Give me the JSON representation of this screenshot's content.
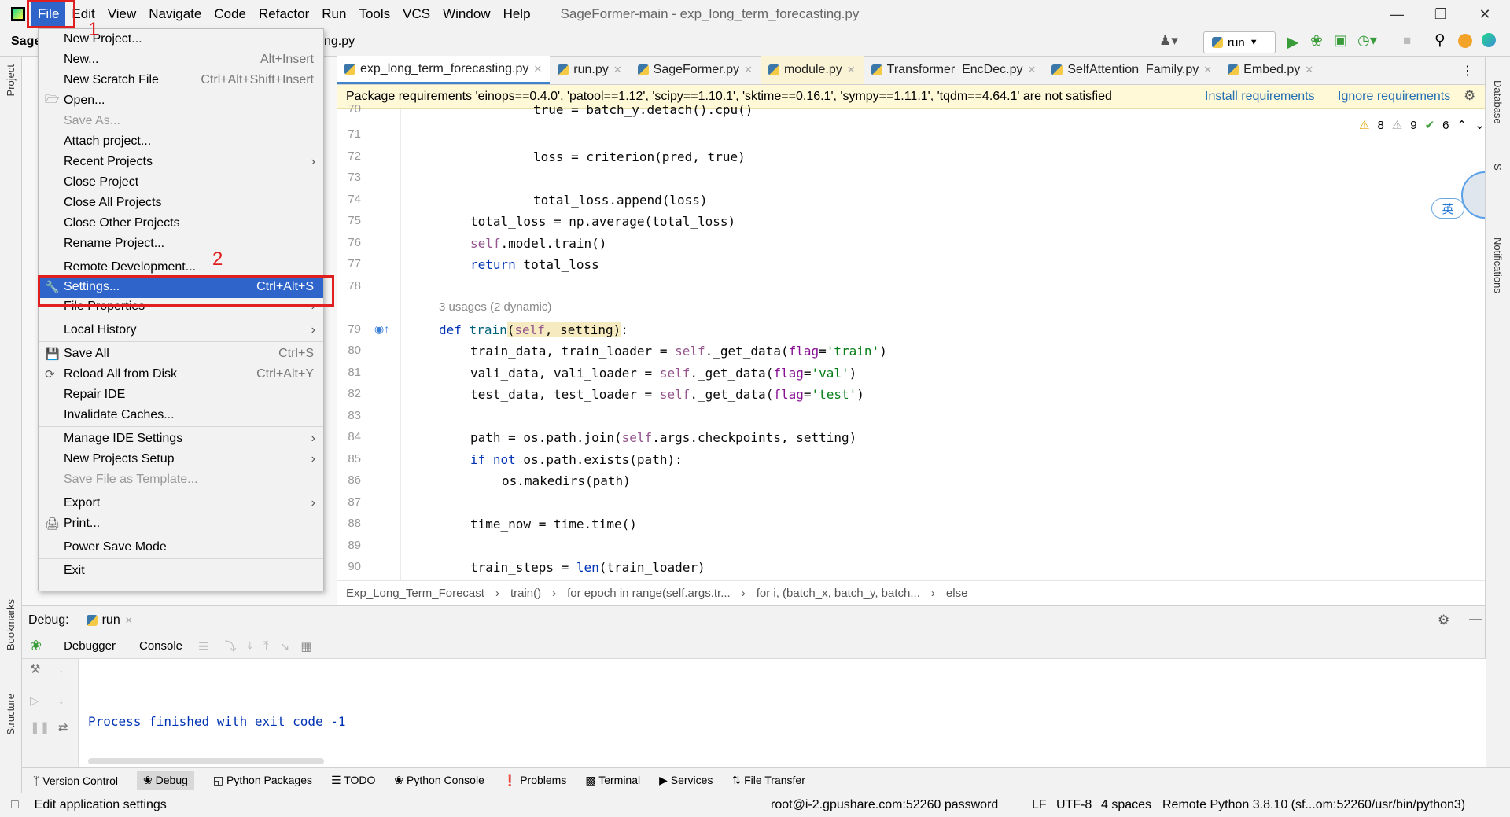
{
  "menubar": {
    "items": [
      "File",
      "Edit",
      "View",
      "Navigate",
      "Code",
      "Refactor",
      "Run",
      "Tools",
      "VCS",
      "Window",
      "Help"
    ],
    "window_title": "SageFormer-main - exp_long_term_forecasting.py"
  },
  "navbar": {
    "project": "Sage",
    "path_tail": "ng.py",
    "run_config": "run"
  },
  "tabs": [
    "exp_long_term_forecasting.py",
    "run.py",
    "SageFormer.py",
    "module.py",
    "Transformer_EncDec.py",
    "SelfAttention_Family.py",
    "Embed.py"
  ],
  "banner": {
    "text": "Package requirements 'einops==0.4.0', 'patool==1.12', 'scipy==1.10.1', 'sktime==0.16.1', 'sympy==1.11.1', 'tqdm==4.64.1' are not satisfied",
    "install": "Install requirements",
    "ignore": "Ignore requirements"
  },
  "inspections": {
    "warnings": "8",
    "weak": "9",
    "ok": "6"
  },
  "usages_hint": "3 usages (2 dynamic)",
  "line_numbers": [
    "70",
    "71",
    "72",
    "73",
    "74",
    "75",
    "76",
    "77",
    "78",
    "79",
    "80",
    "81",
    "82",
    "83",
    "84",
    "85",
    "86",
    "87",
    "88",
    "89",
    "90"
  ],
  "breadcrumb": [
    "Exp_Long_Term_Forecast",
    "train()",
    "for epoch in range(self.args.tr...",
    "for i, (batch_x, batch_y, batch...",
    "else"
  ],
  "file_menu": {
    "items": [
      {
        "label": "New Project...",
        "shortcut": ""
      },
      {
        "label": "New...",
        "shortcut": "Alt+Insert"
      },
      {
        "label": "New Scratch File",
        "shortcut": "Ctrl+Alt+Shift+Insert"
      },
      {
        "label": "Open...",
        "shortcut": ""
      },
      {
        "label": "Save As...",
        "shortcut": ""
      },
      {
        "label": "Attach project...",
        "shortcut": ""
      },
      {
        "label": "Recent Projects",
        "shortcut": ""
      },
      {
        "label": "Close Project",
        "shortcut": ""
      },
      {
        "label": "Close All Projects",
        "shortcut": ""
      },
      {
        "label": "Close Other Projects",
        "shortcut": ""
      },
      {
        "label": "Rename Project...",
        "shortcut": ""
      },
      {
        "label": "Remote Development...",
        "shortcut": ""
      },
      {
        "label": "Settings...",
        "shortcut": "Ctrl+Alt+S"
      },
      {
        "label": "File Properties",
        "shortcut": ""
      },
      {
        "label": "Local History",
        "shortcut": ""
      },
      {
        "label": "Save All",
        "shortcut": "Ctrl+S"
      },
      {
        "label": "Reload All from Disk",
        "shortcut": "Ctrl+Alt+Y"
      },
      {
        "label": "Repair IDE",
        "shortcut": ""
      },
      {
        "label": "Invalidate Caches...",
        "shortcut": ""
      },
      {
        "label": "Manage IDE Settings",
        "shortcut": ""
      },
      {
        "label": "New Projects Setup",
        "shortcut": ""
      },
      {
        "label": "Save File as Template...",
        "shortcut": ""
      },
      {
        "label": "Export",
        "shortcut": ""
      },
      {
        "label": "Print...",
        "shortcut": ""
      },
      {
        "label": "Power Save Mode",
        "shortcut": ""
      },
      {
        "label": "Exit",
        "shortcut": ""
      }
    ]
  },
  "annotations": {
    "one": "1",
    "two": "2"
  },
  "debug": {
    "title": "Debug:",
    "tab": "run",
    "debugger": "Debugger",
    "console": "Console",
    "output": "Process finished with exit code -1"
  },
  "tool_windows": [
    "Version Control",
    "Debug",
    "Python Packages",
    "TODO",
    "Python Console",
    "Problems",
    "Terminal",
    "Services",
    "File Transfer"
  ],
  "side_labels": {
    "project": "Project",
    "bookmarks": "Bookmarks",
    "structure": "Structure",
    "database": "Database",
    "notifications": "Notifications",
    "sciview": "S"
  },
  "ime": "英",
  "statusbar": {
    "hint": "Edit application settings",
    "host": "root@i-2.gpushare.com:52260 password",
    "lf": "LF",
    "encoding": "UTF-8",
    "indent": "4 spaces",
    "interpreter": "Remote Python 3.8.10 (sf...om:52260/usr/bin/python3)"
  }
}
